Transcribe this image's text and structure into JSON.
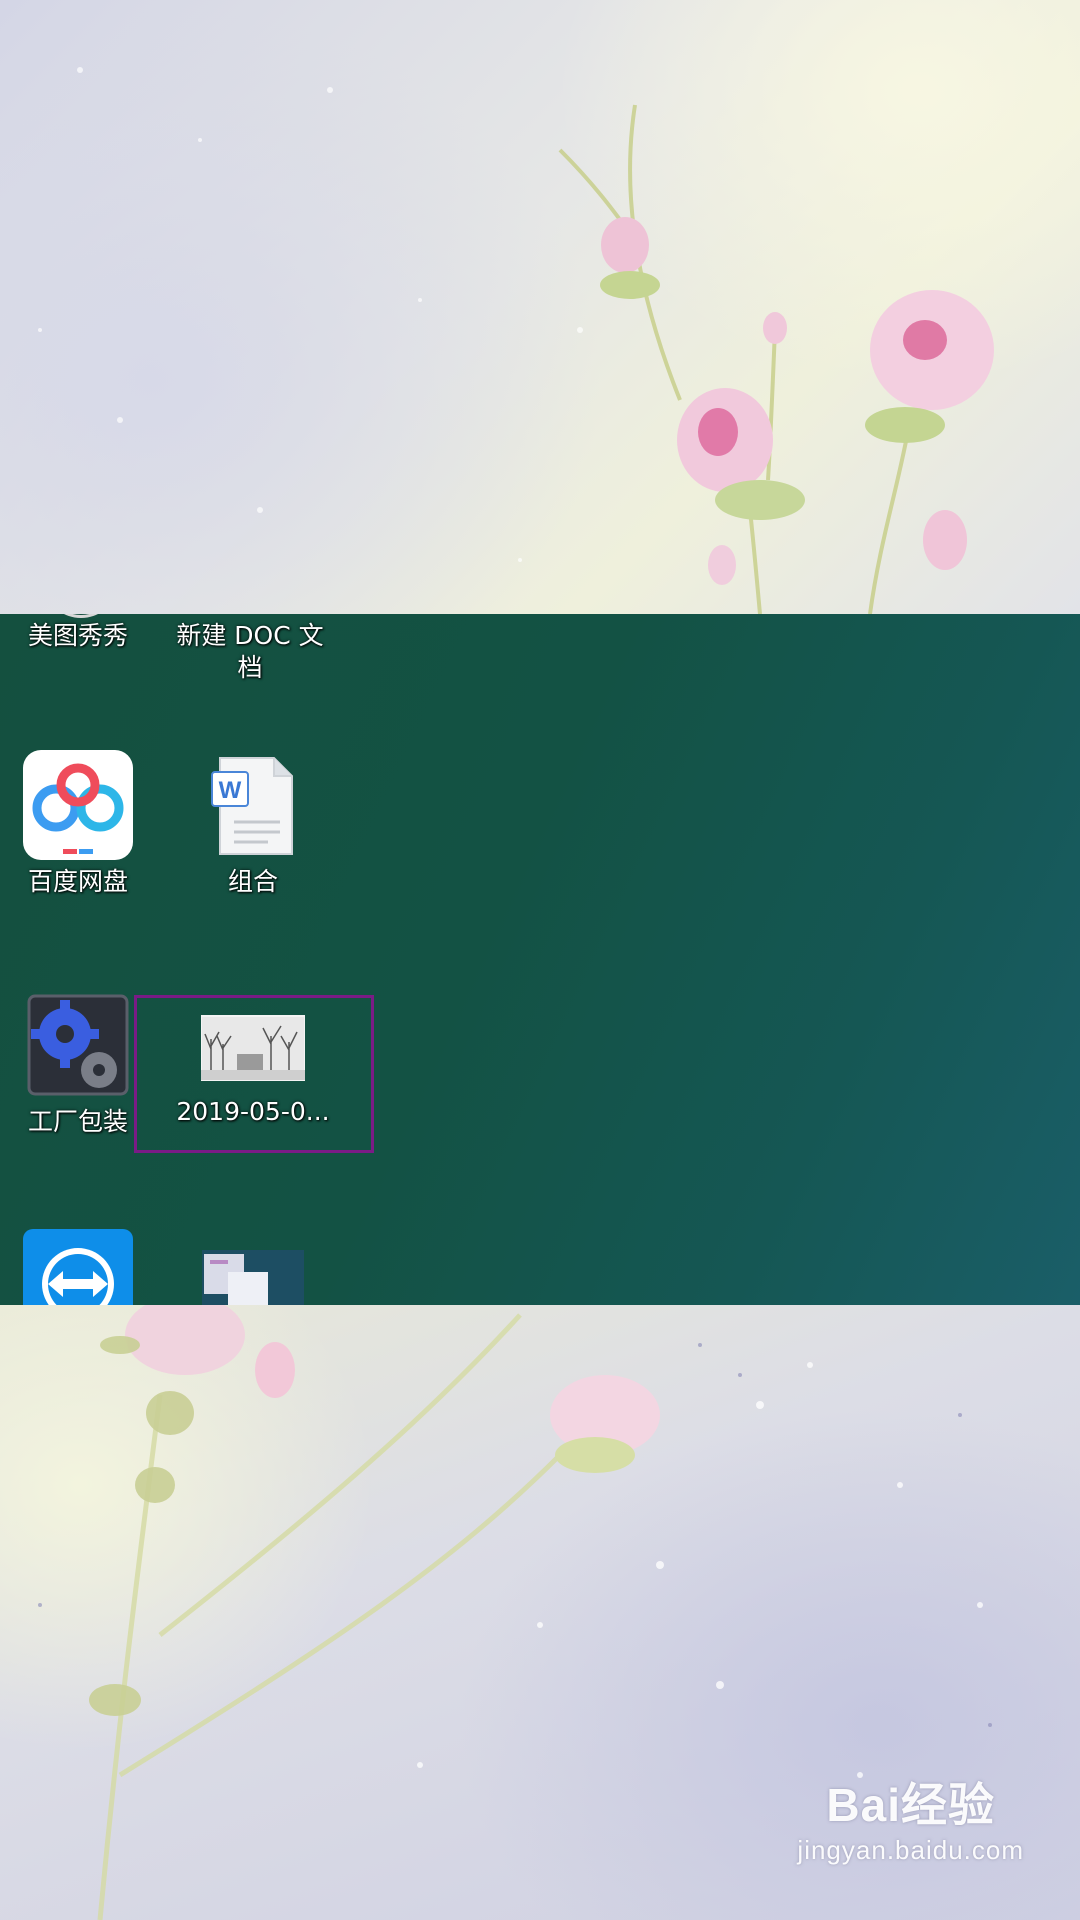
{
  "desktop": {
    "icons": [
      {
        "label": "美图秀秀",
        "icon": "meitu-icon"
      },
      {
        "label": "新建 DOC 文档",
        "icon": "word-doc-icon"
      },
      {
        "label": "百度网盘",
        "icon": "baidu-netdisk-icon"
      },
      {
        "label": "组合",
        "icon": "word-doc-icon"
      },
      {
        "label": "工厂包装",
        "icon": "gear-icon"
      },
      {
        "label": "2019-05-0...",
        "icon": "image-thumbnail-icon",
        "selected": true
      },
      {
        "label": "",
        "icon": "teamviewer-icon"
      },
      {
        "label": "",
        "icon": "screenshot-thumbnail-icon"
      }
    ],
    "highlight_color": "#7a1b86"
  },
  "watermark": {
    "brand": "Bai经验",
    "url": "jingyan.baidu.com"
  }
}
